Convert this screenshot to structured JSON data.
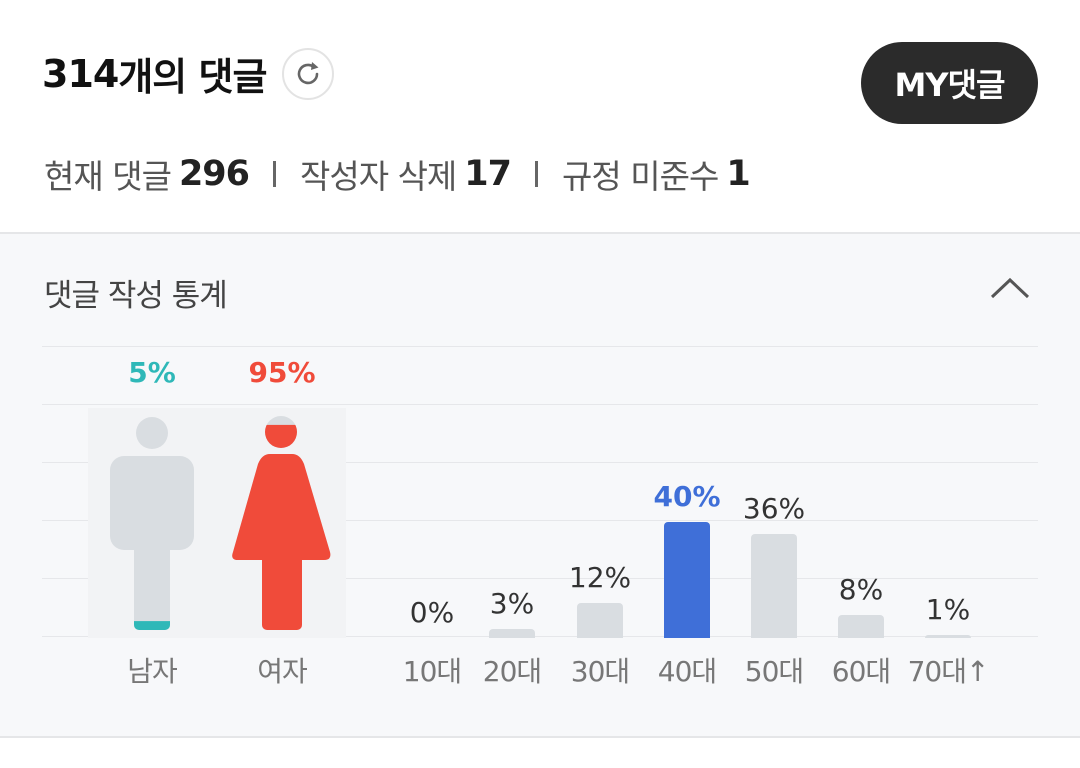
{
  "header": {
    "title_count": "314",
    "title_text": "개의 댓글",
    "my_button": "MY댓글"
  },
  "stats": {
    "current_label": "현재 댓글",
    "current_value": "296",
    "deleted_label": "작성자 삭제",
    "deleted_value": "17",
    "violation_label": "규정 미준수",
    "violation_value": "1"
  },
  "panel": {
    "title": "댓글 작성 통계"
  },
  "colors": {
    "male_accent": "#2fb8b8",
    "female_accent": "#f04b3a",
    "highlight_bar": "#3f6fd8",
    "default_bar": "#d9dde1"
  },
  "chart_data": [
    {
      "type": "bar",
      "categories": [
        "남자",
        "여자"
      ],
      "values": [
        5,
        95
      ],
      "value_labels": [
        "5%",
        "95%"
      ]
    },
    {
      "type": "bar",
      "categories": [
        "10대",
        "20대",
        "30대",
        "40대",
        "50대",
        "60대",
        "70대↑"
      ],
      "values": [
        0,
        3,
        12,
        40,
        36,
        8,
        1
      ],
      "value_labels": [
        "0%",
        "3%",
        "12%",
        "40%",
        "36%",
        "8%",
        "1%"
      ],
      "highlight_index": 3,
      "ylim": [
        0,
        100
      ]
    }
  ]
}
